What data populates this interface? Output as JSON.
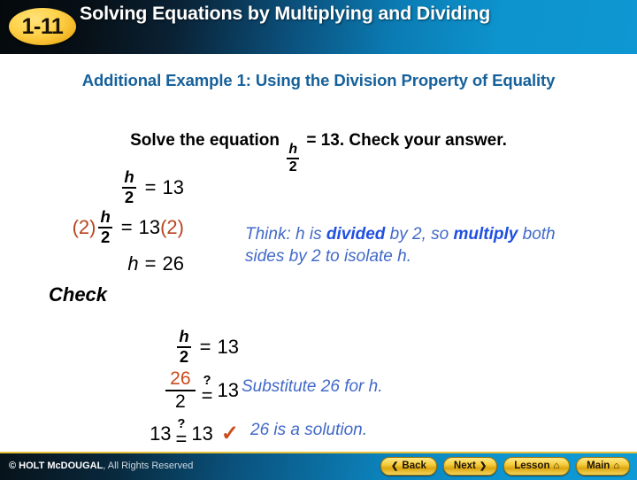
{
  "header": {
    "badge": "1-11",
    "title": "Solving Equations by Multiplying and Dividing"
  },
  "subtitle": "Additional Example 1: Using the Division Property of Equality",
  "prompt": {
    "before": "Solve the equation",
    "fraction_numerator": "h",
    "fraction_denominator": "2",
    "after": "= 13. Check your answer."
  },
  "work": {
    "row1": {
      "numerator": "h",
      "denominator": "2",
      "equals": "=",
      "right": "13"
    },
    "row2": {
      "left_multiplier": "(2)",
      "numerator": "h",
      "denominator": "2",
      "equals": "=",
      "right": "13",
      "right_multiplier": "(2)"
    },
    "row3": {
      "variable": "h",
      "equals": "=",
      "value": "26"
    },
    "check_label": "Check",
    "row4": {
      "numerator": "h",
      "denominator": "2",
      "equals": "=",
      "right": "13"
    },
    "row5": {
      "numerator": "26",
      "denominator": "2",
      "question": "?",
      "equals": "=",
      "right": "13"
    },
    "row6": {
      "left": "13",
      "question": "?",
      "equals": "=",
      "right": "13",
      "checkmark": "✓"
    }
  },
  "notes": {
    "think_1": "Think: h is ",
    "think_bold_1": "divided",
    "think_2": " by 2, so ",
    "think_bold_2": "multiply",
    "think_3": " both sides by 2 to isolate h.",
    "substitute": "Substitute 26 for h.",
    "solution": "26 is a solution."
  },
  "footer": {
    "copyright_bold": "© HOLT McDOUGAL",
    "copyright_rest": ", All Rights Reserved",
    "buttons": [
      {
        "label": "Back",
        "glyph": "❮",
        "glyph_side": "left"
      },
      {
        "label": "Next",
        "glyph": "❯",
        "glyph_side": "right"
      },
      {
        "label": "Lesson",
        "glyph": "⌂",
        "glyph_side": "right"
      },
      {
        "label": "Main",
        "glyph": "⌂",
        "glyph_side": "right"
      }
    ]
  },
  "colors": {
    "header_dark": "#05090c",
    "header_blue": "#0e97d2",
    "badge_gold": "#ffd24a",
    "subtitle_blue": "#16619b",
    "note_blue": "#4169c8",
    "note_bold_blue": "#2050e0",
    "highlight_orange": "#cc4a1c",
    "button_gold": "#f6cf41"
  }
}
